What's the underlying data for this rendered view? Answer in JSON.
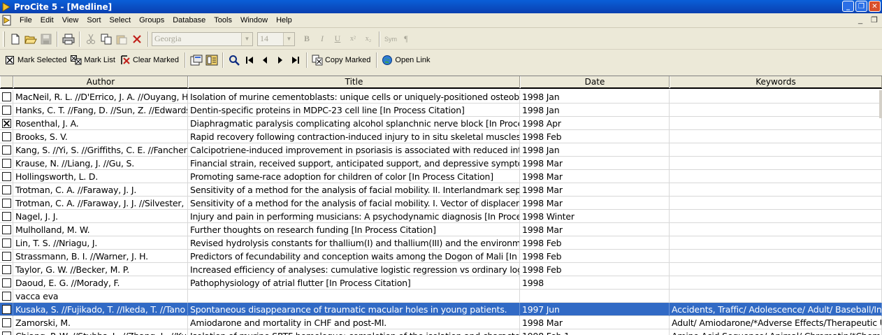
{
  "window": {
    "title": "ProCite 5 - [Medline]"
  },
  "window_buttons": {
    "minimize": "_",
    "restore": "❐",
    "close": "✕"
  },
  "menu": [
    "File",
    "Edit",
    "View",
    "Sort",
    "Select",
    "Groups",
    "Database",
    "Tools",
    "Window",
    "Help"
  ],
  "mdi_buttons": {
    "minimize": "_",
    "restore": "❐"
  },
  "format_toolbar": {
    "font": "Georgia",
    "size": "14",
    "bold": "B",
    "italic": "I",
    "underline": "U",
    "superscript": "x²",
    "subscript": "x₂",
    "symbol": "Sym",
    "paragraph": "¶"
  },
  "toolbar2": {
    "mark_selected": "Mark Selected",
    "mark_list": "Mark List",
    "clear_marked": "Clear Marked",
    "copy_marked": "Copy Marked",
    "open_link": "Open Link"
  },
  "columns": {
    "author": "Author",
    "title": "Title",
    "date": "Date",
    "keywords": "Keywords"
  },
  "rows": [
    {
      "checked": false,
      "selected": false,
      "author": "MacNeil, R. L. //D'Errico, J. A. //Ouyang, H.",
      "title": "Isolation of murine cementoblasts: unique cells or uniquely-positioned osteoblasts",
      "date": "1998 Jan",
      "keywords": ""
    },
    {
      "checked": false,
      "selected": false,
      "author": "Hanks, C. T. //Fang, D. //Sun, Z. //Edwards,",
      "title": "Dentin-specific proteins in MDPC-23 cell line [In Process Citation]",
      "date": "1998 Jan",
      "keywords": ""
    },
    {
      "checked": true,
      "selected": false,
      "author": "Rosenthal, J. A.",
      "title": "Diaphragmatic paralysis complicating alcohol splanchnic nerve block [In Process",
      "date": "1998 Apr",
      "keywords": ""
    },
    {
      "checked": false,
      "selected": false,
      "author": "Brooks, S. V.",
      "title": "Rapid recovery following contraction-induced injury to in situ skeletal muscles in",
      "date": "1998 Feb",
      "keywords": ""
    },
    {
      "checked": false,
      "selected": false,
      "author": "Kang, S. //Yi, S. //Griffiths, C. E. //Fancher, L",
      "title": "Calcipotriene-induced improvement in psoriasis is associated with reduced inter",
      "date": "1998 Jan",
      "keywords": ""
    },
    {
      "checked": false,
      "selected": false,
      "author": "Krause, N. //Liang, J. //Gu, S.",
      "title": "Financial strain, received support, anticipated support, and depressive symptom",
      "date": "1998 Mar",
      "keywords": ""
    },
    {
      "checked": false,
      "selected": false,
      "author": "Hollingsworth, L. D.",
      "title": "Promoting same-race adoption for children of color [In Process Citation]",
      "date": "1998 Mar",
      "keywords": ""
    },
    {
      "checked": false,
      "selected": false,
      "author": "Trotman, C. A. //Faraway, J. J.",
      "title": "Sensitivity of a method for the analysis of facial mobility. II. Interlandmark separat",
      "date": "1998 Mar",
      "keywords": ""
    },
    {
      "checked": false,
      "selected": false,
      "author": "Trotman, C. A. //Faraway, J. J. //Silvester, K",
      "title": "Sensitivity of a method for the analysis of facial mobility. I. Vector of displacemen",
      "date": "1998 Mar",
      "keywords": ""
    },
    {
      "checked": false,
      "selected": false,
      "author": "Nagel, J. J.",
      "title": "Injury and pain in performing musicians: A psychodynamic diagnosis [In Process",
      "date": "1998 Winter",
      "keywords": ""
    },
    {
      "checked": false,
      "selected": false,
      "author": "Mulholland, M. W.",
      "title": "Further thoughts on research funding [In Process Citation]",
      "date": "1998 Mar",
      "keywords": ""
    },
    {
      "checked": false,
      "selected": false,
      "author": "Lin, T. S. //Nriagu, J.",
      "title": "Revised hydrolysis constants for thallium(I) and thallium(III) and the environmente",
      "date": "1998 Feb",
      "keywords": ""
    },
    {
      "checked": false,
      "selected": false,
      "author": "Strassmann, B. I. //Warner, J. H.",
      "title": "Predictors of fecundability and conception waits among the Dogon of Mali [In Pro",
      "date": "1998 Feb",
      "keywords": ""
    },
    {
      "checked": false,
      "selected": false,
      "author": "Taylor, G. W. //Becker, M. P.",
      "title": "Increased efficiency of analyses: cumulative logistic regression vs ordinary logis",
      "date": "1998 Feb",
      "keywords": ""
    },
    {
      "checked": false,
      "selected": false,
      "author": "Daoud, E. G. //Morady, F.",
      "title": "Pathophysiology of atrial flutter [In Process Citation]",
      "date": "1998",
      "keywords": ""
    },
    {
      "checked": false,
      "selected": false,
      "author": "vacca eva",
      "title": "",
      "date": "",
      "keywords": ""
    },
    {
      "checked": false,
      "selected": true,
      "author": "Kusaka, S. //Fujikado, T. //Ikeda, T. //Tano",
      "title": "Spontaneous disappearance of traumatic macular holes in young patients.",
      "date": "1997 Jun",
      "keywords": "Accidents, Traffic/ Adolescence/ Adult/ Baseball/In"
    },
    {
      "checked": false,
      "selected": false,
      "author": "Zamorski, M.",
      "title": "Amiodarone and mortality in CHF and post-MI.",
      "date": "1998 Mar",
      "keywords": "Adult/ Amiodarone/*Adverse Effects/Therapeutic U"
    },
    {
      "checked": false,
      "selected": false,
      "author": "Chiang, P. W. //Stubbs, L. //Zhang, L. //Kurn",
      "title": "Isolation of murine SRTF homologue: completion of the isolation and characteriza",
      "date": "1998 Feb 1",
      "keywords": "Amino Acid Sequence/ Animal/ Chromatin/*Chemi"
    }
  ]
}
